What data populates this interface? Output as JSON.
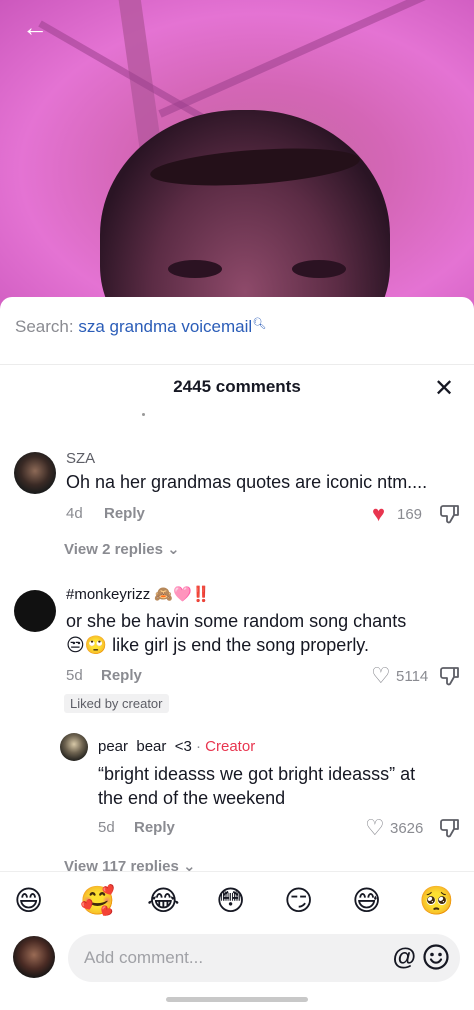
{
  "search": {
    "label": "Search:",
    "term": "sza grandma voicemail"
  },
  "header": {
    "count_label": "2445 comments"
  },
  "comments": [
    {
      "username": "SZA",
      "text": "Oh na her grandmas quotes are iconic ntm....",
      "time": "4d",
      "reply_label": "Reply",
      "likes": "169",
      "view_replies": "View 2 replies"
    },
    {
      "username": "#monkeyrizz 🙈🩷‼️",
      "text_line1": "or she be havin some random song chants",
      "text_line2": "😒🙄 like girl js end the song properly.",
      "time": "5d",
      "reply_label": "Reply",
      "likes": "5114",
      "liked_badge": "Liked by creator",
      "view_replies": "View 117 replies"
    }
  ],
  "reply": {
    "username": "pear  bear  <3",
    "separator": "·",
    "creator_tag": "Creator",
    "text_line1": "“bright ideasss we got bright ideasss” at",
    "text_line2": "the end of the weekend",
    "time": "5d",
    "reply_label": "Reply",
    "likes": "3626"
  },
  "emoji_bar": [
    "😄",
    "🥰",
    "😂",
    "😳",
    "😏",
    "😅",
    "🥺"
  ],
  "composer": {
    "placeholder": "Add comment...",
    "at_label": "@"
  },
  "colors": {
    "accent": "#e8354f",
    "search_term": "#2b5db8",
    "muted": "#8a8b91"
  }
}
